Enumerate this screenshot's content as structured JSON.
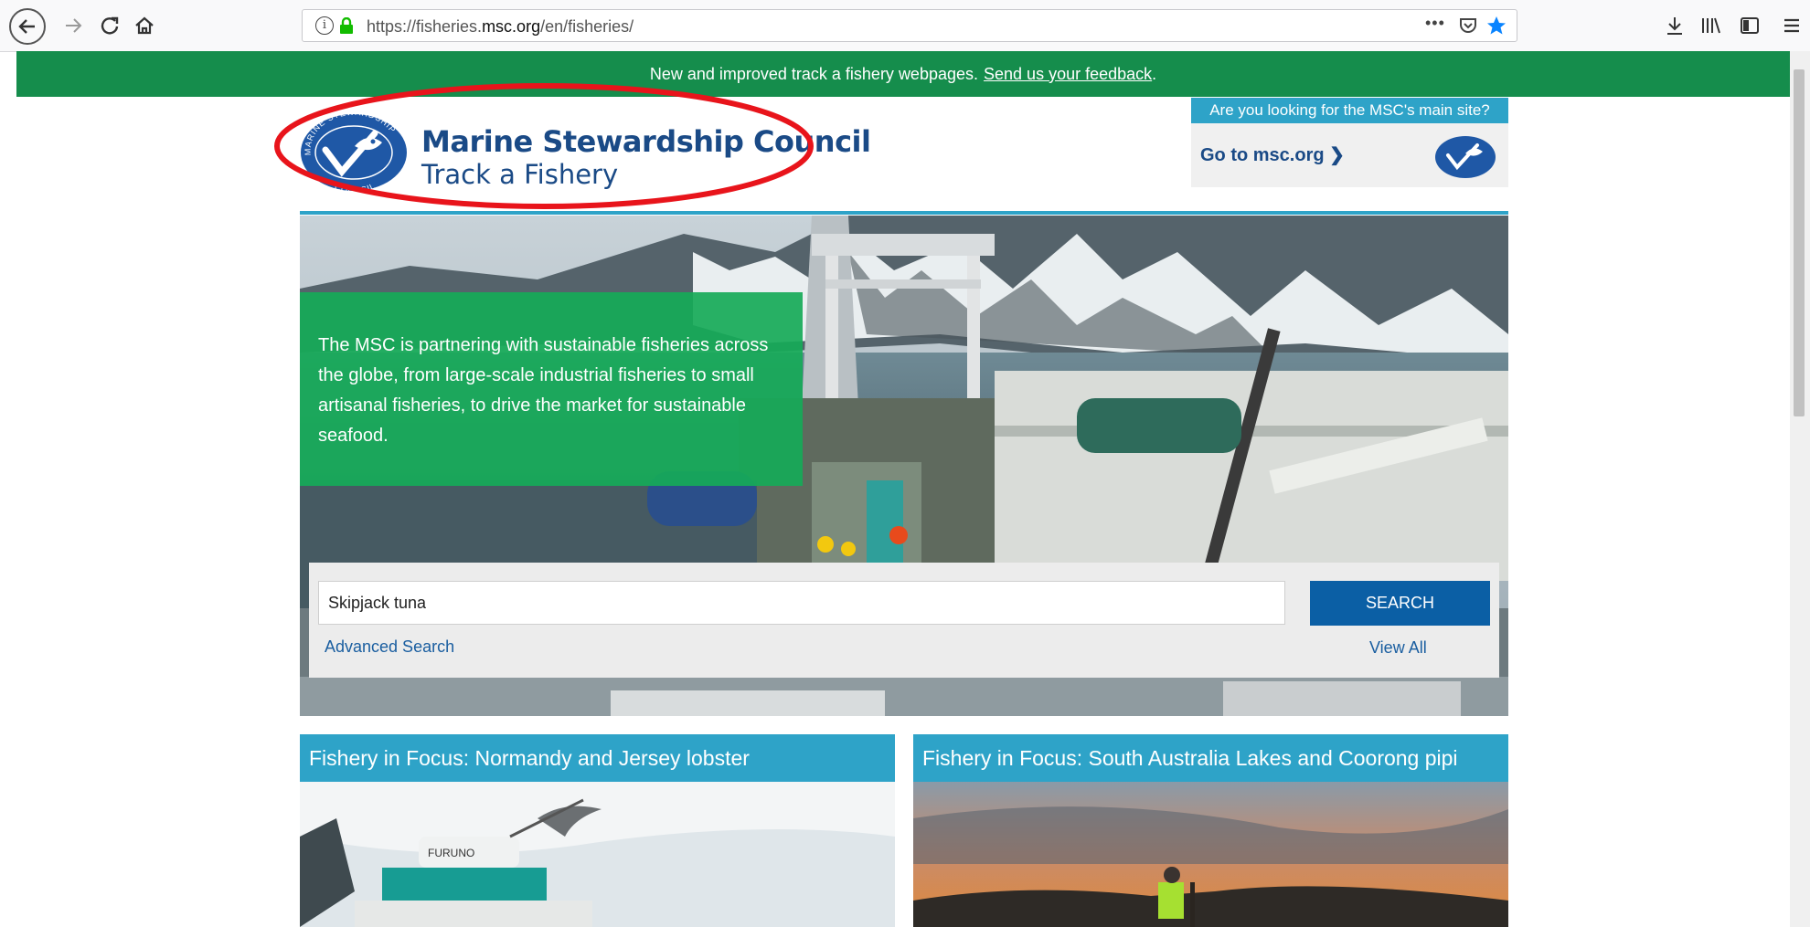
{
  "browser": {
    "url_prefix": "https://fisheries.",
    "url_domain": "msc.org",
    "url_path": "/en/fisheries/",
    "more_label": "•••"
  },
  "notice": {
    "text": "New and improved track a fishery webpages.",
    "link": "Send us your feedback",
    "trailing": "."
  },
  "header": {
    "title": "Marine Stewardship Council",
    "subtitle": "Track a Fishery",
    "logo_ring_top": "MARINE STEWARDSHIP",
    "logo_ring_bottom": "COUNCIL",
    "main_site_question": "Are you looking for the MSC's main site?",
    "main_site_link": "Go to msc.org"
  },
  "hero": {
    "text": "The MSC is partnering with sustainable fisheries across the globe, from large-scale industrial fisheries to small artisanal fisheries, to drive the market for sustainable seafood."
  },
  "search": {
    "value": "Skipjack tuna",
    "button": "SEARCH",
    "advanced": "Advanced Search",
    "view_all": "View All"
  },
  "cards": [
    {
      "title": "Fishery in Focus: Normandy and Jersey lobster"
    },
    {
      "title": "Fishery in Focus: South Australia Lakes and Coorong pipi"
    }
  ],
  "colors": {
    "notice_green": "#158d4c",
    "accent_blue": "#2ea3c8",
    "brand_navy": "#1a4a86",
    "button_blue": "#0b5fa5",
    "hero_green": "#16aa58",
    "annotation_red": "#e8141b"
  }
}
